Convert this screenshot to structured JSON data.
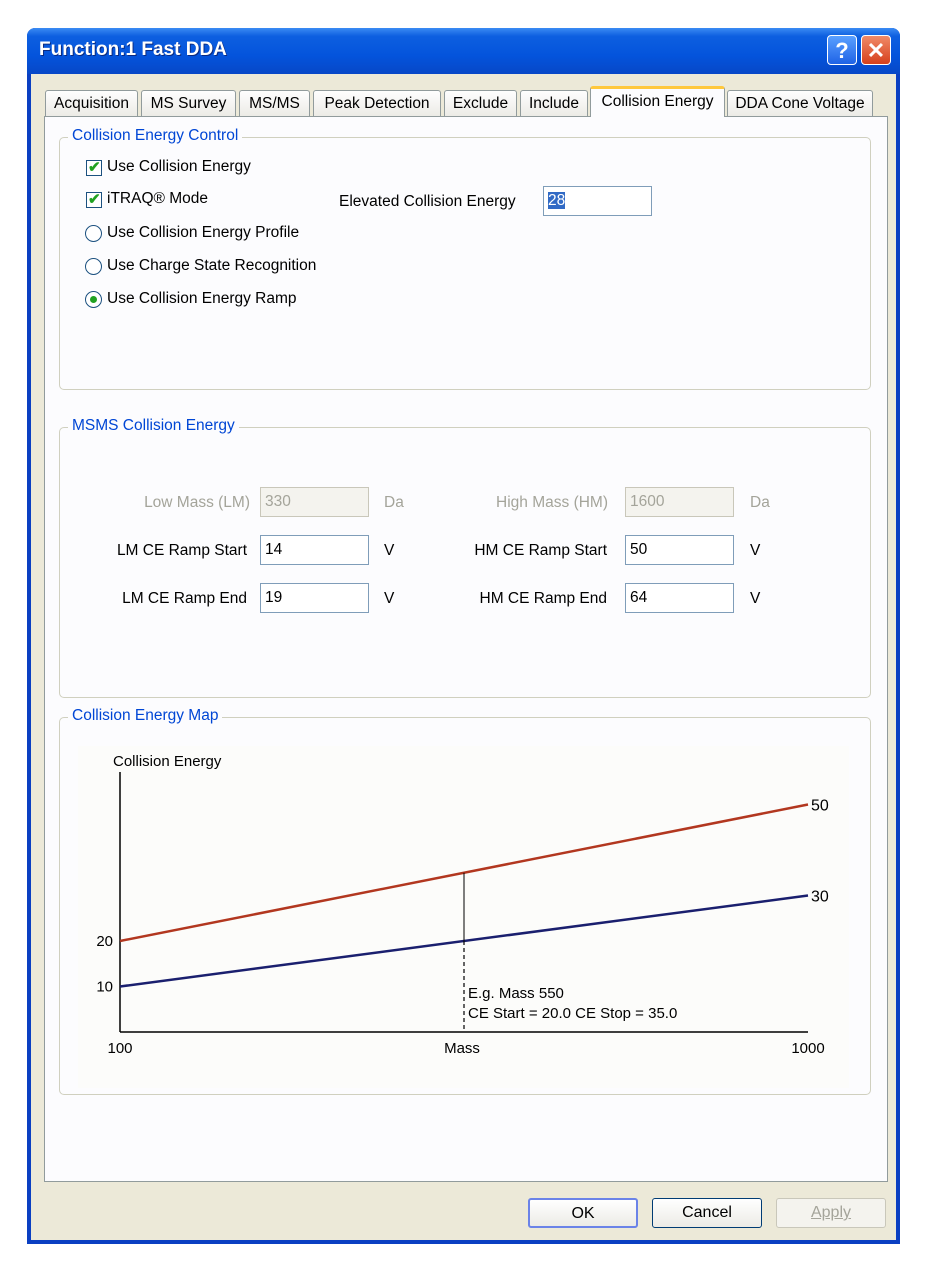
{
  "window": {
    "title": "Function:1 Fast DDA",
    "help_glyph": "?",
    "close_glyph": "✕"
  },
  "tabs": [
    {
      "label": "Acquisition"
    },
    {
      "label": "MS Survey"
    },
    {
      "label": "MS/MS"
    },
    {
      "label": "Peak Detection"
    },
    {
      "label": "Exclude"
    },
    {
      "label": "Include"
    },
    {
      "label": "Collision Energy"
    },
    {
      "label": "DDA Cone Voltage"
    }
  ],
  "active_tab": "Collision Energy",
  "control_group": {
    "legend": "Collision Energy Control",
    "use_ce_label": "Use Collision Energy",
    "use_ce_checked": true,
    "itraq_label": "iTRAQ® Mode",
    "itraq_checked": true,
    "elevated_label": "Elevated Collision Energy",
    "elevated_value": "28",
    "radios": [
      {
        "label": "Use Collision Energy Profile",
        "selected": false
      },
      {
        "label": "Use Charge State Recognition",
        "selected": false
      },
      {
        "label": "Use Collision Energy Ramp",
        "selected": true
      }
    ]
  },
  "msms_group": {
    "legend": "MSMS Collision Energy",
    "low_mass_label": "Low Mass (LM)",
    "low_mass_value": "330",
    "low_mass_unit": "Da",
    "high_mass_label": "High Mass (HM)",
    "high_mass_value": "1600",
    "high_mass_unit": "Da",
    "lm_start_label": "LM CE Ramp Start",
    "lm_start_value": "14",
    "lm_start_unit": "V",
    "hm_start_label": "HM CE Ramp Start",
    "hm_start_value": "50",
    "hm_start_unit": "V",
    "lm_end_label": "LM CE Ramp End",
    "lm_end_value": "19",
    "lm_end_unit": "V",
    "hm_end_label": "HM CE Ramp End",
    "hm_end_value": "64",
    "hm_end_unit": "V"
  },
  "map_group": {
    "legend": "Collision Energy Map"
  },
  "chart_data": {
    "type": "line",
    "ylabel": "Collision Energy",
    "xlabel": "Mass",
    "xlim": [
      100,
      1000
    ],
    "x_tick_labels": [
      "100",
      "1000"
    ],
    "y_tick_labels": [
      "20",
      "10"
    ],
    "series": [
      {
        "color": "#b2371f",
        "x": [
          100,
          1000
        ],
        "y": [
          20,
          50
        ],
        "end_label": "50"
      },
      {
        "color": "#1a1f6e",
        "x": [
          100,
          1000
        ],
        "y": [
          10,
          30
        ],
        "end_label": "30"
      }
    ],
    "marker": {
      "mass": 550
    },
    "annotation_lines": [
      "E.g. Mass 550",
      "CE Start = 20.0  CE Stop = 35.0"
    ]
  },
  "buttons": {
    "ok": "OK",
    "cancel": "Cancel",
    "apply": "Apply"
  }
}
